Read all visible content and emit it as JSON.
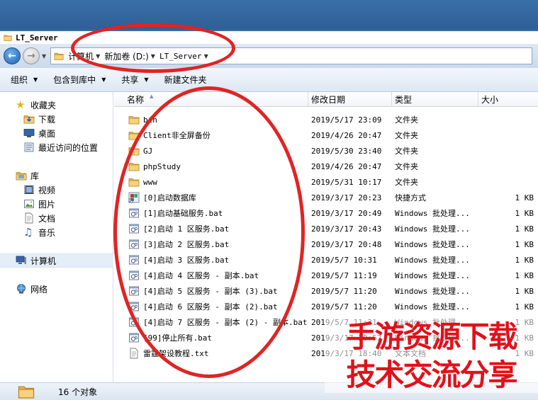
{
  "window": {
    "title": "LT_Server"
  },
  "address": {
    "crumbs": [
      "计算机",
      "新加卷 (D:)",
      "LT_Server"
    ]
  },
  "toolbar": {
    "items": [
      "组织",
      "包含到库中",
      "共享",
      "新建文件夹"
    ]
  },
  "sidebar": {
    "favorites": {
      "label": "收藏夹",
      "items": [
        "下载",
        "桌面",
        "最近访问的位置"
      ]
    },
    "libraries": {
      "label": "库",
      "items": [
        "视频",
        "图片",
        "文档",
        "音乐"
      ]
    },
    "computer": "计算机",
    "network": "网络"
  },
  "columns": {
    "name": "名称",
    "date": "修改日期",
    "type": "类型",
    "size": "大小"
  },
  "files": [
    {
      "icon": "folder",
      "name": "bin",
      "date": "2019/5/17 23:09",
      "type": "文件夹",
      "size": ""
    },
    {
      "icon": "folder",
      "name": "Client非全屏备份",
      "date": "2019/4/26 20:47",
      "type": "文件夹",
      "size": ""
    },
    {
      "icon": "folder",
      "name": "GJ",
      "date": "2019/5/30 23:40",
      "type": "文件夹",
      "size": ""
    },
    {
      "icon": "folder",
      "name": "phpStudy",
      "date": "2019/4/26 20:47",
      "type": "文件夹",
      "size": ""
    },
    {
      "icon": "folder",
      "name": "www",
      "date": "2019/5/31 10:17",
      "type": "文件夹",
      "size": ""
    },
    {
      "icon": "shortcut",
      "name": "[0]启动数据库",
      "date": "2019/3/17 20:23",
      "type": "快捷方式",
      "size": "1 KB"
    },
    {
      "icon": "bat",
      "name": "[1]启动基础服务.bat",
      "date": "2019/3/17 20:49",
      "type": "Windows 批处理...",
      "size": "1 KB"
    },
    {
      "icon": "bat",
      "name": "[2]启动 1 区服务.bat",
      "date": "2019/3/17 20:43",
      "type": "Windows 批处理...",
      "size": "1 KB"
    },
    {
      "icon": "bat",
      "name": "[3]启动 2 区服务.bat",
      "date": "2019/3/17 20:48",
      "type": "Windows 批处理...",
      "size": "1 KB"
    },
    {
      "icon": "bat",
      "name": "[4]启动 3 区服务.bat",
      "date": "2019/5/7 10:31",
      "type": "Windows 批处理...",
      "size": "1 KB"
    },
    {
      "icon": "bat",
      "name": "[4]启动 4 区服务 - 副本.bat",
      "date": "2019/5/7 11:19",
      "type": "Windows 批处理...",
      "size": "1 KB"
    },
    {
      "icon": "bat",
      "name": "[4]启动 5 区服务 - 副本 (3).bat",
      "date": "2019/5/7 11:20",
      "type": "Windows 批处理...",
      "size": "1 KB"
    },
    {
      "icon": "bat",
      "name": "[4]启动 6 区服务 - 副本 (2).bat",
      "date": "2019/5/7 11:20",
      "type": "Windows 批处理...",
      "size": "1 KB"
    },
    {
      "icon": "bat",
      "name": "[4]启动 7 区服务 - 副本 (2) - 副本.bat",
      "date": "2019/5/7 11:21",
      "type": "Windows 批处理...",
      "size": "1 KB"
    },
    {
      "icon": "bat",
      "name": "[99]停止所有.bat",
      "date": "2019/3/17 20:52",
      "type": "Windows 批处理...",
      "size": "1 KB"
    },
    {
      "icon": "txt",
      "name": "雷霆架设教程.txt",
      "date": "2019/3/17 18:40",
      "type": "文本文档",
      "size": "1 KB"
    }
  ],
  "status": {
    "count": "16 个对象"
  },
  "watermark": {
    "line1": "手游资源下载",
    "line2": "技术交流分享"
  },
  "colors": {
    "annotation": "#e02424",
    "watermark": "#e0111b",
    "selection": "#e5eef8"
  }
}
